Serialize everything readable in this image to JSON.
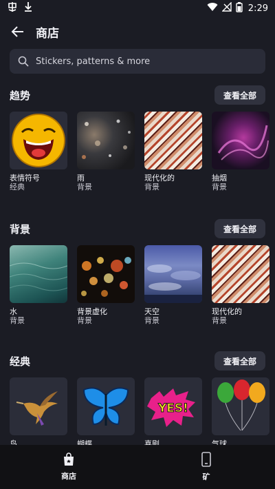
{
  "status_bar": {
    "time": "2:29"
  },
  "header": {
    "back_label": "back",
    "title": "商店"
  },
  "search": {
    "placeholder": "Stickers, patterns & more"
  },
  "colors": {
    "background": "#1b1c24",
    "card": "#2b2d39",
    "nav": "#111114"
  },
  "sections": [
    {
      "title": "趋势",
      "see_all": "查看全部",
      "items": [
        {
          "name": "表情符号",
          "category": "经典",
          "icon": "laughing-emoji"
        },
        {
          "name": "雨",
          "category": "背景",
          "icon": "rain-window"
        },
        {
          "name": "现代化的",
          "category": "背景",
          "icon": "modern-abstract"
        },
        {
          "name": "抽烟",
          "category": "背景",
          "icon": "purple-smoke"
        }
      ]
    },
    {
      "title": "背景",
      "see_all": "查看全部",
      "items": [
        {
          "name": "水",
          "category": "背景",
          "icon": "water-surface"
        },
        {
          "name": "背景虚化",
          "category": "背景",
          "icon": "bokeh-lights"
        },
        {
          "name": "天空",
          "category": "背景",
          "icon": "cloudy-sky"
        },
        {
          "name": "现代化的",
          "category": "背景",
          "icon": "modern-abstract"
        }
      ]
    },
    {
      "title": "经典",
      "see_all": "查看全部",
      "items": [
        {
          "name": "鸟",
          "category": "",
          "icon": "hummingbird"
        },
        {
          "name": "蝴蝶",
          "category": "",
          "icon": "blue-butterfly"
        },
        {
          "name": "喜剧",
          "category": "",
          "icon": "yes-comic-bubble"
        },
        {
          "name": "气球",
          "category": "",
          "icon": "balloons"
        }
      ]
    }
  ],
  "bottom_nav": [
    {
      "label": "商店",
      "icon": "shopping-bag-icon"
    },
    {
      "label": "矿",
      "icon": "phone-icon"
    }
  ]
}
